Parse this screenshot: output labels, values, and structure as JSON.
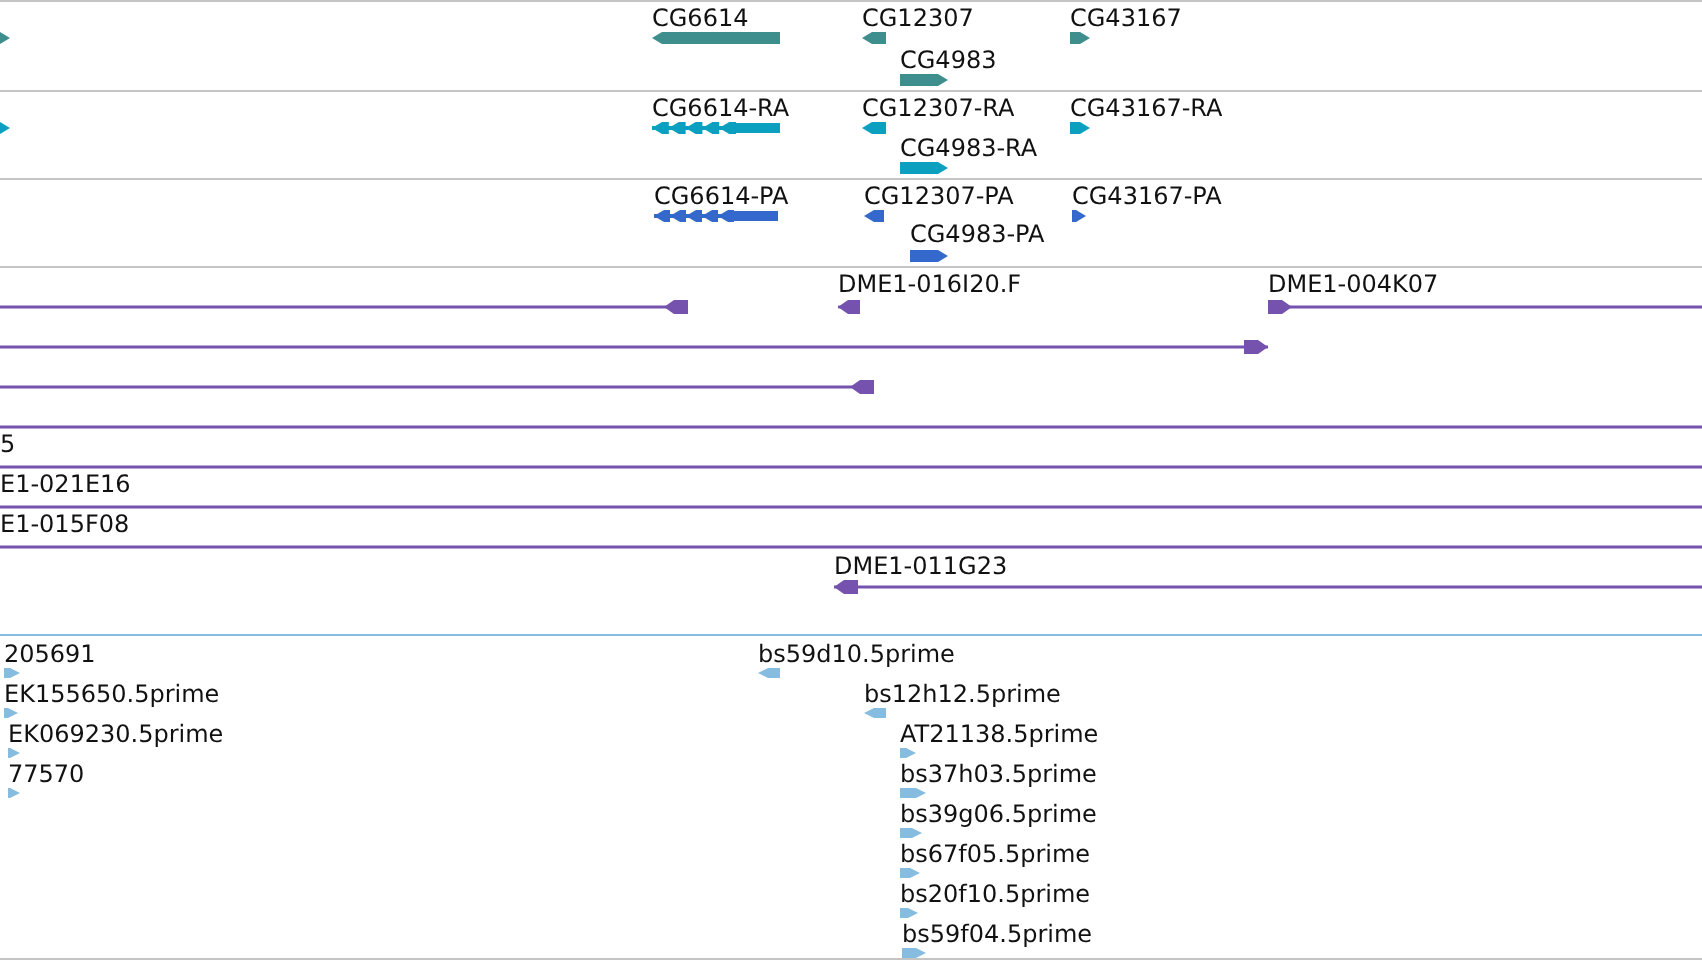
{
  "tracks": [
    {
      "kind": "gene",
      "color": "#3e8e8e",
      "features": [
        {
          "reverse": false
        },
        {
          "label": "CG6614",
          "reverse": true
        },
        {
          "label": "CG12307",
          "reverse": true
        },
        {
          "label": "CG4983",
          "reverse": false
        },
        {
          "label": "CG43167",
          "reverse": false
        }
      ]
    },
    {
      "kind": "transcript",
      "color": "#0ba0bf",
      "features": [
        {
          "reverse": false
        },
        {
          "label": "CG6614-RA",
          "reverse": true
        },
        {
          "label": "CG12307-RA",
          "reverse": true
        },
        {
          "label": "CG4983-RA",
          "reverse": false
        },
        {
          "label": "CG43167-RA",
          "reverse": false
        }
      ]
    },
    {
      "kind": "transcript",
      "color": "#3468cc",
      "features": [
        {
          "label": "CG6614-PA",
          "reverse": true
        },
        {
          "label": "CG12307-PA",
          "reverse": true
        },
        {
          "label": "CG4983-PA",
          "reverse": false
        },
        {
          "label": "CG43167-PA",
          "reverse": false
        }
      ]
    },
    {
      "kind": "clone",
      "color": "#7452ad",
      "features": [
        {
          "kind": "arrow",
          "reverse": true
        },
        {
          "kind": "arrow",
          "label": "DME1-016I20.F",
          "reverse": true
        },
        {
          "kind": "arrow",
          "label": "DME1-004K07",
          "reverse": false
        },
        {
          "kind": "arrow",
          "reverse": false
        },
        {
          "kind": "arrow",
          "reverse": true
        },
        {
          "kind": "line"
        },
        {
          "kind": "line",
          "label": "5"
        },
        {
          "kind": "line",
          "label": "E1-021E16"
        },
        {
          "kind": "line",
          "label": "E1-015F08"
        },
        {
          "kind": "arrow",
          "label": "DME1-011G23",
          "reverse": true
        }
      ]
    },
    {
      "kind": "est",
      "color": "#86bce0",
      "features": [
        {
          "label": "205691",
          "reverse": false
        },
        {
          "label": "EK155650.5prime",
          "reverse": false
        },
        {
          "label": "EK069230.5prime",
          "reverse": false
        },
        {
          "label": "77570",
          "reverse": false
        },
        {
          "label": "bs59d10.5prime",
          "reverse": true
        },
        {
          "label": "bs12h12.5prime",
          "reverse": true
        },
        {
          "label": "AT21138.5prime",
          "reverse": false
        },
        {
          "label": "bs37h03.5prime",
          "reverse": false
        },
        {
          "label": "bs39g06.5prime",
          "reverse": false
        },
        {
          "label": "bs67f05.5prime",
          "reverse": false
        },
        {
          "label": "bs20f10.5prime",
          "reverse": false
        },
        {
          "label": "bs59f04.5prime",
          "reverse": false
        }
      ]
    }
  ]
}
